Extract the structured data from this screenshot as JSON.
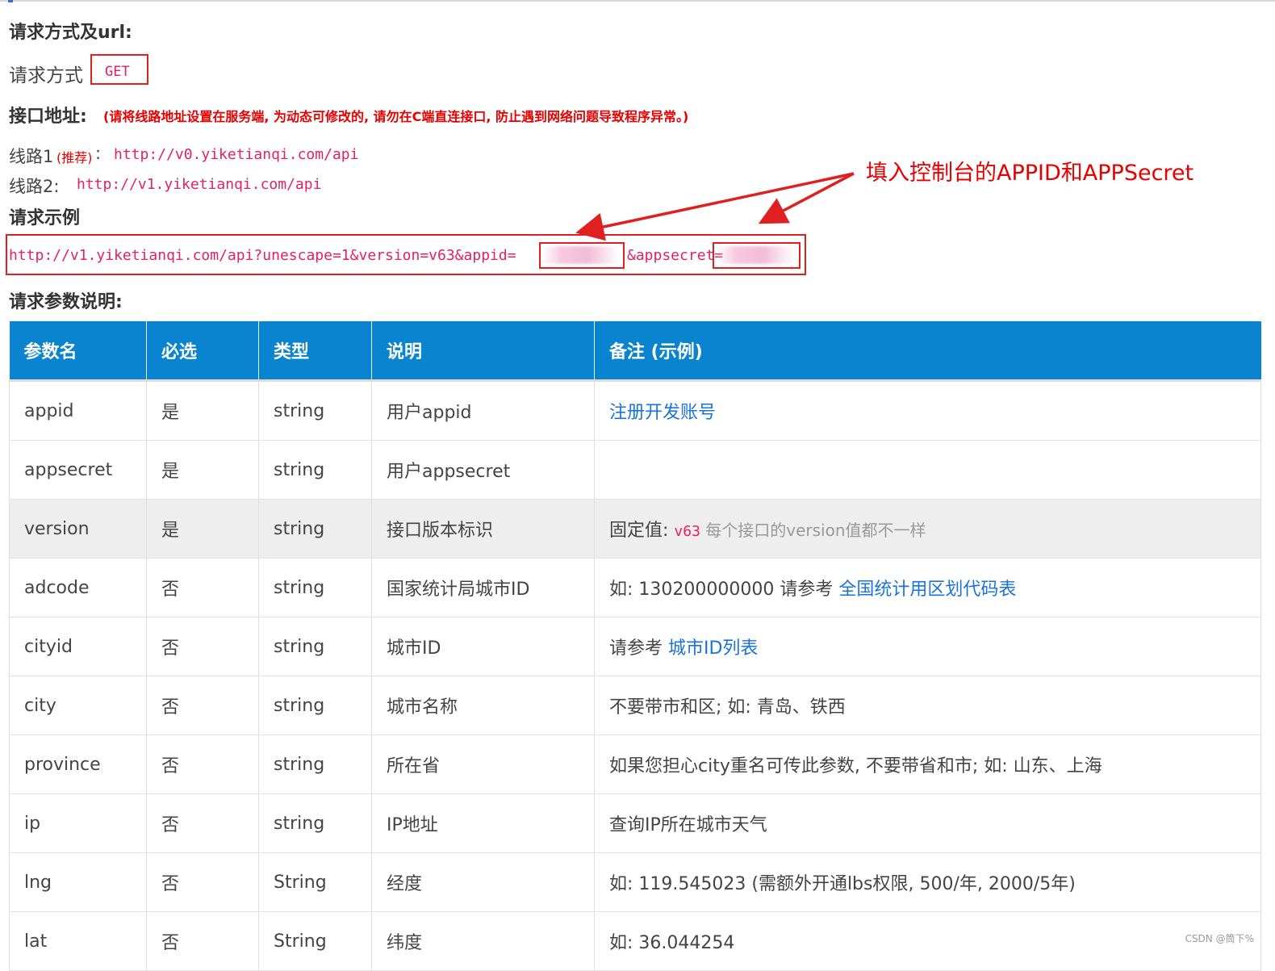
{
  "section_method_title": "请求方式及url:",
  "method_label": "请求方式",
  "method_value": "GET",
  "endpoint_title": "接口地址:",
  "endpoint_note": "(请将线路地址设置在服务端, 为动态可修改的, 请勿在C端直连接口, 防止遇到网络问题导致程序异常。)",
  "line1_label": "线路1",
  "line1_tag": "(推荐)",
  "line1_sep": ":",
  "line1_url": "http://v0.yiketianqi.com/api",
  "line2_label": "线路2:",
  "line2_url": "http://v1.yiketianqi.com/api",
  "example_title": "请求示例",
  "example_url_prefix": "http://v1.yiketianqi.com/api?unescape=1&version=v63&appid=",
  "example_url_mid": "&appsecret=",
  "annotation": "填入控制台的APPID和APPSecret",
  "params_title": "请求参数说明:",
  "table": {
    "headers": [
      "参数名",
      "必选",
      "类型",
      "说明",
      "备注 (示例)"
    ],
    "rows": [
      {
        "name": "appid",
        "required": "是",
        "type": "string",
        "desc": "用户appid",
        "note_prefix": "",
        "note_link": "注册开发账号"
      },
      {
        "name": "appsecret",
        "required": "是",
        "type": "string",
        "desc": "用户appsecret",
        "note_prefix": "",
        "note_link": ""
      },
      {
        "name": "version",
        "required": "是",
        "type": "string",
        "desc": "接口版本标识",
        "note_prefix": "固定值: ",
        "note_code": "v63",
        "note_muted": " 每个接口的version值都不一样"
      },
      {
        "name": "adcode",
        "required": "否",
        "type": "string",
        "desc": "国家统计局城市ID",
        "note_prefix": "如: 130200000000 请参考 ",
        "note_link": "全国统计用区划代码表"
      },
      {
        "name": "cityid",
        "required": "否",
        "type": "string",
        "desc": "城市ID",
        "note_prefix": "请参考 ",
        "note_link": "城市ID列表"
      },
      {
        "name": "city",
        "required": "否",
        "type": "string",
        "desc": "城市名称",
        "note_prefix": "不要带市和区; 如: 青岛、铁西",
        "note_link": ""
      },
      {
        "name": "province",
        "required": "否",
        "type": "string",
        "desc": "所在省",
        "note_prefix": "如果您担心city重名可传此参数, 不要带省和市; 如: 山东、上海",
        "note_link": ""
      },
      {
        "name": "ip",
        "required": "否",
        "type": "string",
        "desc": "IP地址",
        "note_prefix": "查询IP所在城市天气",
        "note_link": ""
      },
      {
        "name": "lng",
        "required": "否",
        "type": "String",
        "desc": "经度",
        "note_prefix": "如: 119.545023 (需额外开通lbs权限, 500/年, 2000/5年)",
        "note_link": ""
      },
      {
        "name": "lat",
        "required": "否",
        "type": "String",
        "desc": "纬度",
        "note_prefix": "如: 36.044254",
        "note_link": ""
      }
    ]
  },
  "watermark": "CSDN @筒下%",
  "colors": {
    "header_bg": "#0a84cf",
    "link": "#1a73d9",
    "code": "#e4215f",
    "annotation": "#e80000",
    "highlight_row": "#eeeeee"
  }
}
